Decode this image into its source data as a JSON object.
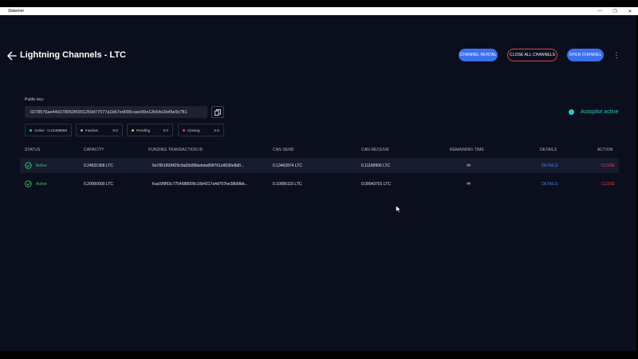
{
  "window": {
    "title": "Stakenet",
    "controls": {
      "minimize": "—",
      "restore": "❐",
      "close": "✕"
    }
  },
  "header": {
    "title": "Lightning Channels - LTC",
    "buttons": {
      "rental": "CHANNEL RENTAL",
      "close_all": "CLOSE ALL CHANNELS",
      "open": "OPEN CHANNEL"
    },
    "more_icon": "⋮"
  },
  "public_key": {
    "label": "Public key:",
    "value": "0278576ae44d178953f6901259d77077a1b67ed095caee99e12b54e2b45e9c781"
  },
  "stats": [
    {
      "label": "Active",
      "value": "0.24498969",
      "color": "#38c96a"
    },
    {
      "label": "Inactive",
      "value": "0.0",
      "color": "#9aa0b4"
    },
    {
      "label": "Pending",
      "value": "0.0",
      "color": "#f2b233"
    },
    {
      "label": "Closing",
      "value": "0.0",
      "color": "#e0434f"
    }
  ],
  "autopilot": {
    "label": "Autopilot active",
    "color": "#2ec4c9"
  },
  "table": {
    "headers": [
      "STATUS",
      "CAPACITY",
      "FUNDING TRANSACTION ID",
      "CAN SEND",
      "CAN RECEIVE",
      "REMAINING TIME",
      "DETAILS",
      "ACTION"
    ],
    "rows": [
      {
        "status": "Active",
        "capacity": "0.24631958 LTC",
        "funding_tx": "6e7851f60f420c9a93d06befebd59f761e8036e8d0...",
        "can_send": "0.13462874 LTC",
        "can_receive": "0.11168900 LTC",
        "remaining": "∞",
        "details": "DETAILS",
        "action": "CLOSE"
      },
      {
        "status": "Active",
        "capacity": "0.20000000 LTC",
        "funding_tx": "fcac5f9f93c7754988909c10b4217a4d767be38b5fbb...",
        "can_send": "0.10956115 LTC",
        "can_receive": "0.09043701 LTC",
        "remaining": "∞",
        "details": "DETAILS",
        "action": "CLOSE"
      }
    ]
  },
  "colors": {
    "accent": "#3d6ff1",
    "danger": "#e0434f",
    "success": "#38c96a",
    "background": "#0b0e1c"
  }
}
